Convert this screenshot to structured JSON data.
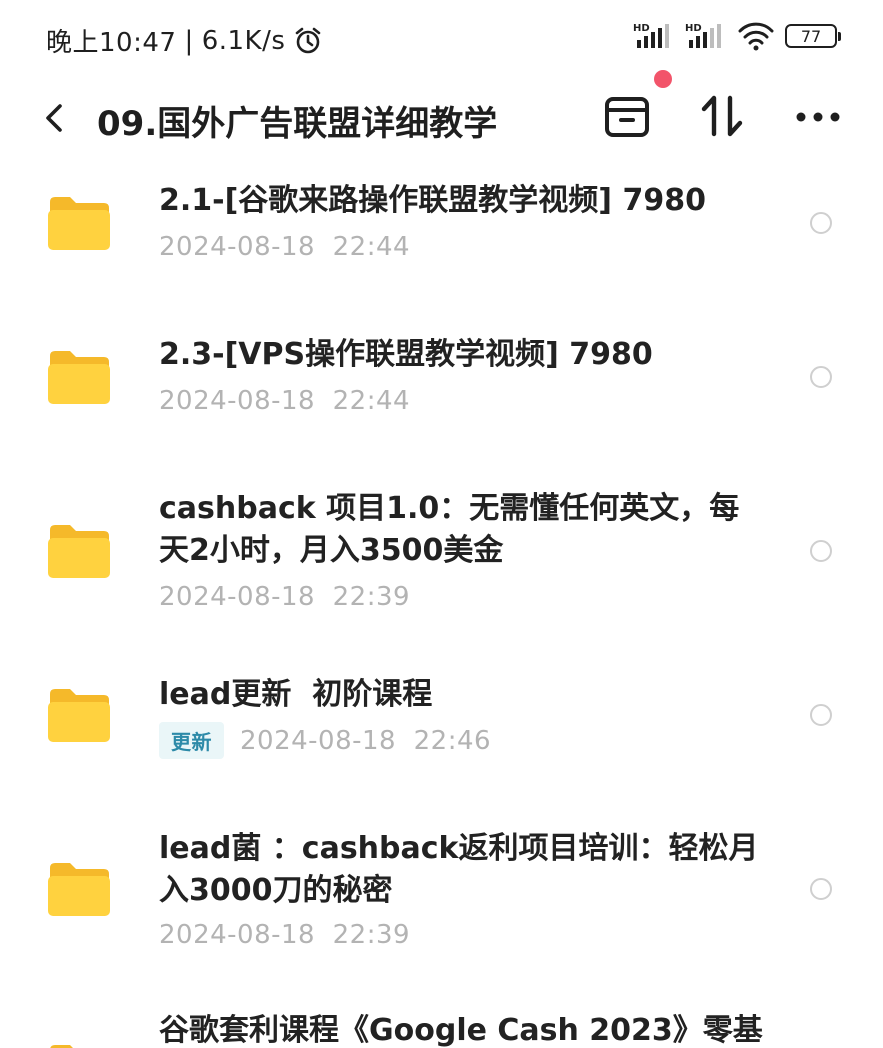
{
  "status_bar": {
    "time": "晚上10:47",
    "separator": "|",
    "speed": "6.1K/s",
    "battery": "77",
    "icons": [
      "alarm-icon",
      "signal-hd-icon",
      "signal-hd-icon",
      "wifi-icon",
      "battery-icon"
    ]
  },
  "header": {
    "back_icon": "back-icon",
    "title": "09.国外广告联盟详细教学",
    "actions": [
      "archive-icon",
      "sort-icon",
      "more-icon"
    ],
    "notification_color": "#f2546a"
  },
  "files": [
    {
      "name": "2.1-[谷歌来路操作联盟教学视频] 7980",
      "date": "2024-08-18  22:44",
      "badge": ""
    },
    {
      "name": "2.3-[VPS操作联盟教学视频] 7980",
      "date": "2024-08-18  22:44",
      "badge": ""
    },
    {
      "name": "cashback 项目1.0：无需懂任何英文，每天2小时，月入3500美金",
      "date": "2024-08-18  22:39",
      "badge": ""
    },
    {
      "name": "lead更新  初阶课程",
      "date": "2024-08-18  22:46",
      "badge": "更新"
    },
    {
      "name": "lead菌 ：cashback返利项目培训：轻松月入3000刀的秘密",
      "date": "2024-08-18  22:39",
      "badge": ""
    },
    {
      "name": "谷歌套利课程《Google Cash 2023》零基",
      "date": "",
      "badge": ""
    }
  ],
  "colors": {
    "folder": "#ffd23f",
    "badge_bg": "#eaf6f8",
    "badge_text": "#2d8aa8",
    "meta_text": "#b3b3b3"
  }
}
